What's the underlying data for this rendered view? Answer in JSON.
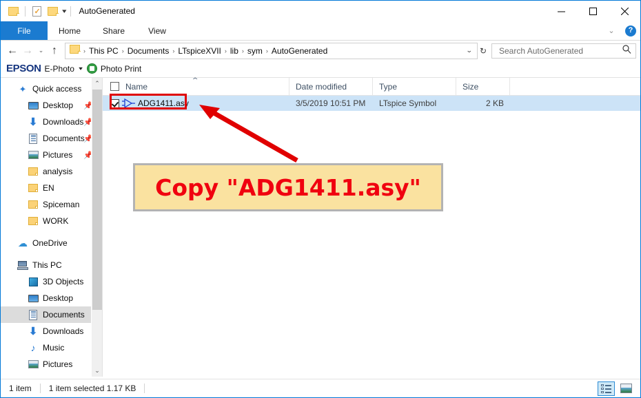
{
  "window": {
    "title": "AutoGenerated",
    "quick_access_toolbar": [
      {
        "name": "folder-icon",
        "label": ""
      },
      {
        "name": "properties-icon",
        "label": ""
      },
      {
        "name": "new-folder-icon",
        "label": ""
      },
      {
        "name": "customize-caret",
        "label": "▾"
      }
    ],
    "controls": {
      "minimize": "—",
      "maximize": "☐",
      "close": "✕"
    }
  },
  "ribbon": {
    "tabs": [
      {
        "label": "File",
        "active": true
      },
      {
        "label": "Home",
        "active": false
      },
      {
        "label": "Share",
        "active": false
      },
      {
        "label": "View",
        "active": false
      }
    ],
    "collapse_caret": "⌄",
    "help_label": "?"
  },
  "address": {
    "back": "←",
    "forward": "→",
    "recent": "⌄",
    "up": "↑",
    "crumbs": [
      "This PC",
      "Documents",
      "LTspiceXVII",
      "lib",
      "sym",
      "AutoGenerated"
    ],
    "separator": "›",
    "dropdown_caret": "⌄",
    "refresh": "↻"
  },
  "search": {
    "placeholder": "Search AutoGenerated",
    "value": "",
    "icon": "search-icon"
  },
  "epson_toolbar": {
    "logo": "EPSON",
    "ephoto_label": "E-Photo",
    "caret": "▾",
    "photo_print_label": "Photo Print"
  },
  "sidebar": {
    "items": [
      {
        "label": "Quick access",
        "icon": "star-icon",
        "level": 0,
        "pinned": false,
        "selected": false
      },
      {
        "label": "Desktop",
        "icon": "desktop-icon",
        "level": 1,
        "pinned": true,
        "selected": false
      },
      {
        "label": "Downloads",
        "icon": "download-icon",
        "level": 1,
        "pinned": true,
        "selected": false
      },
      {
        "label": "Documents",
        "icon": "documents-icon",
        "level": 1,
        "pinned": true,
        "selected": false
      },
      {
        "label": "Pictures",
        "icon": "pictures-icon",
        "level": 1,
        "pinned": true,
        "selected": false
      },
      {
        "label": "analysis",
        "icon": "folder-icon",
        "level": 1,
        "pinned": false,
        "selected": false
      },
      {
        "label": "EN",
        "icon": "folder-icon",
        "level": 1,
        "pinned": false,
        "selected": false
      },
      {
        "label": "Spiceman",
        "icon": "folder-icon",
        "level": 1,
        "pinned": false,
        "selected": false
      },
      {
        "label": "WORK",
        "icon": "folder-icon",
        "level": 1,
        "pinned": false,
        "selected": false
      },
      {
        "label": "OneDrive",
        "icon": "cloud-icon",
        "level": 0,
        "pinned": false,
        "selected": false
      },
      {
        "label": "This PC",
        "icon": "computer-icon",
        "level": 0,
        "pinned": false,
        "selected": false
      },
      {
        "label": "3D Objects",
        "icon": "cube-icon",
        "level": 1,
        "pinned": false,
        "selected": false
      },
      {
        "label": "Desktop",
        "icon": "desktop-icon",
        "level": 1,
        "pinned": false,
        "selected": false
      },
      {
        "label": "Documents",
        "icon": "documents-icon",
        "level": 1,
        "pinned": false,
        "selected": true
      },
      {
        "label": "Downloads",
        "icon": "download-icon",
        "level": 1,
        "pinned": false,
        "selected": false
      },
      {
        "label": "Music",
        "icon": "music-icon",
        "level": 1,
        "pinned": false,
        "selected": false
      },
      {
        "label": "Pictures",
        "icon": "pictures-icon",
        "level": 1,
        "pinned": false,
        "selected": false
      }
    ],
    "pin_glyph": "📌",
    "scroll_up": "⌃",
    "scroll_down": "⌄"
  },
  "filelist": {
    "columns": [
      {
        "label": "Name",
        "sorted": true,
        "sort_dir": "asc"
      },
      {
        "label": "Date modified",
        "sorted": false
      },
      {
        "label": "Type",
        "sorted": false
      },
      {
        "label": "Size",
        "sorted": false
      }
    ],
    "sort_arrow": "⌃",
    "rows": [
      {
        "name": "ADG1411.asy",
        "date_modified": "3/5/2019 10:51 PM",
        "type": "LTspice Symbol",
        "size": "2 KB",
        "checked": true,
        "selected": true,
        "icon": "ltspice-symbol-icon"
      }
    ]
  },
  "annotation": {
    "callout_text": "Copy \"ADG1411.asy\"",
    "callout_bg": "#fae2a0",
    "callout_border": "#b3b3b3",
    "text_color": "#f0000f",
    "arrow_color": "#e00000",
    "highlight_color": "#e00000"
  },
  "statusbar": {
    "item_count": "1 item",
    "selection": "1 item selected  1.17 KB",
    "views": [
      {
        "name": "details-view",
        "active": true
      },
      {
        "name": "large-icons-view",
        "active": false
      }
    ]
  }
}
